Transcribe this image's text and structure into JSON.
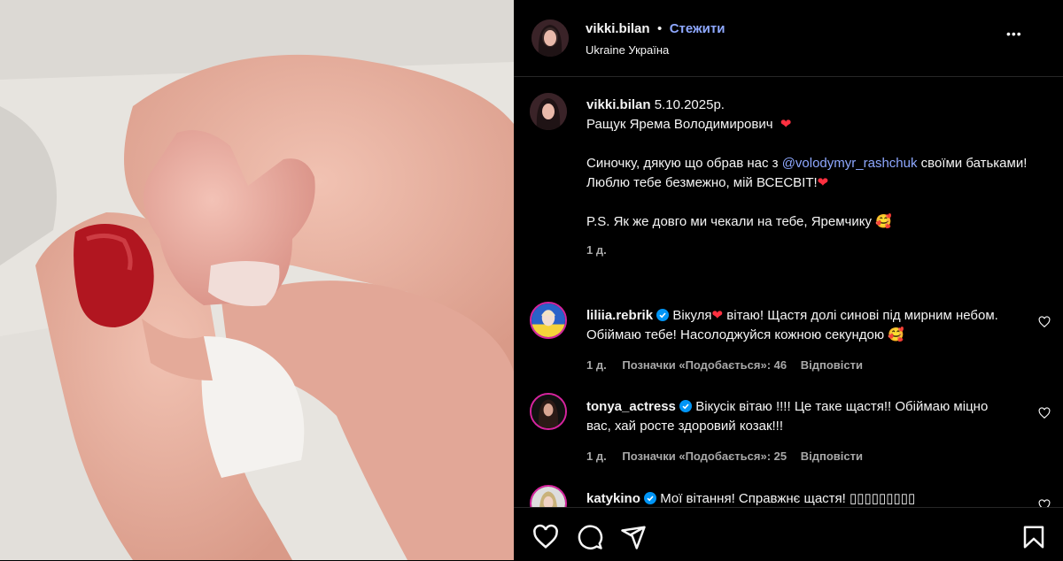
{
  "header": {
    "username": "vikki.bilan",
    "follow": "Стежити",
    "location": "Ukraine Україна",
    "more": "•••"
  },
  "post": {
    "username": "vikki.bilan",
    "date": "5.10.2025р.",
    "line1": "Ращук Ярема Володимирович",
    "line2_prefix": "Синочку, дякую що обрав нас з ",
    "mention": "@volodymyr_rashchuk",
    "line2_suffix": " своїми батьками!",
    "line3": "Люблю тебе безмежно, мій ВСЕСВІТ!",
    "line4": "P.S. Як же довго ми чекали на тебе, Яремчику",
    "time": "1 д."
  },
  "comments": [
    {
      "username": "liliia.rebrik",
      "text_a": "Вікуля",
      "text_b": " вітаю! Щастя долі синові під мирним небом. Обіймаю тебе! Насолоджуйся кожною секундою",
      "time": "1 д.",
      "likes": "Позначки «Подобається»: 46",
      "reply": "Відповісти"
    },
    {
      "username": "tonya_actress",
      "text_a": "Вікусік вітаю !!!! Це таке щастя!! Обіймаю міцно вас, хай росте здоровий козак!!!",
      "time": "1 д.",
      "likes": "Позначки «Подобається»: 25",
      "reply": "Відповісти"
    },
    {
      "username": "katykino",
      "text_a": "Мої вітання! Справжнє щастя! ▯▯▯▯▯▯▯▯▯"
    }
  ],
  "colors": {
    "accent": "#8ea8ff",
    "verified": "#0095f6",
    "heart": "#ff3040"
  },
  "icons": [
    "heart-icon",
    "comment-icon",
    "share-icon",
    "bookmark-icon",
    "more-icon",
    "verified-icon"
  ]
}
